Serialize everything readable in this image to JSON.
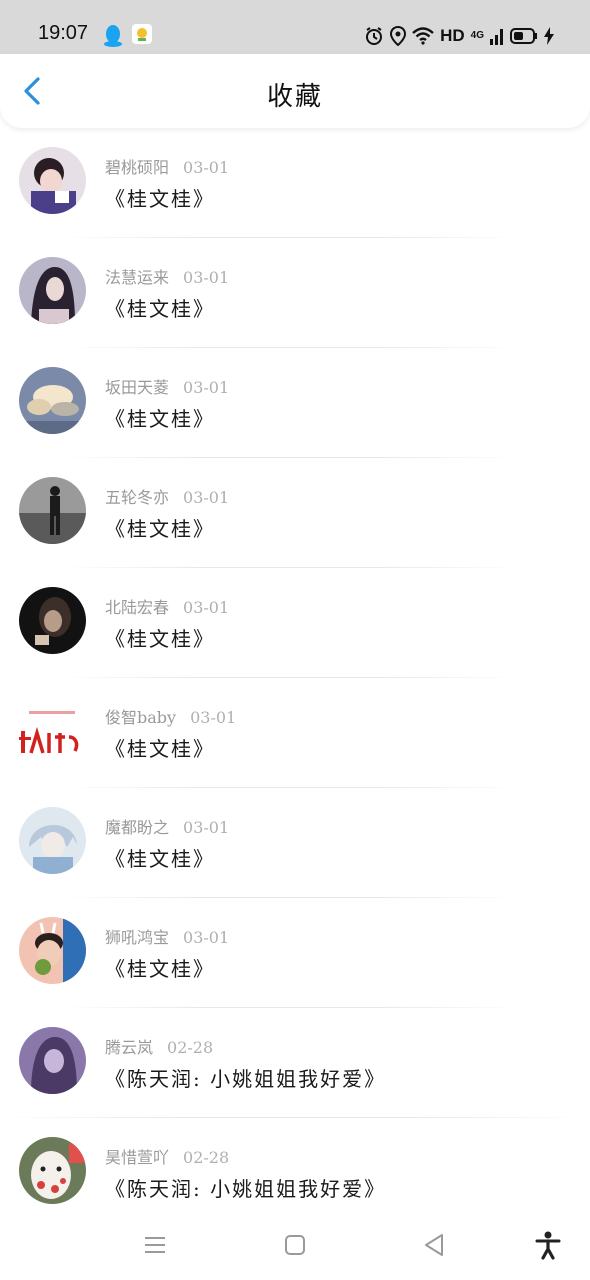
{
  "status_bar": {
    "time": "19:07",
    "hd_label": "HD",
    "network_label": "4G",
    "icons": [
      "qq-icon",
      "app-icon",
      "alarm-icon",
      "location-icon",
      "wifi-icon",
      "signal-icon",
      "battery-icon",
      "charging-icon"
    ]
  },
  "header": {
    "title": "收藏",
    "back_icon": "chevron-left-icon",
    "accent_color": "#2a8fdc"
  },
  "favorites": [
    {
      "name": "碧桃硕阳",
      "date": "03-01",
      "content": "《桂文桂》"
    },
    {
      "name": "法慧运来",
      "date": "03-01",
      "content": "《桂文桂》"
    },
    {
      "name": "坂田天菱",
      "date": "03-01",
      "content": "《桂文桂》"
    },
    {
      "name": "五轮冬亦",
      "date": "03-01",
      "content": "《桂文桂》"
    },
    {
      "name": "北陆宏春",
      "date": "03-01",
      "content": "《桂文桂》"
    },
    {
      "name": "俊智baby",
      "date": "03-01",
      "content": "《桂文桂》"
    },
    {
      "name": "魔都盼之",
      "date": "03-01",
      "content": "《桂文桂》"
    },
    {
      "name": "狮吼鸿宝",
      "date": "03-01",
      "content": "《桂文桂》"
    },
    {
      "name": "腾云岚",
      "date": "02-28",
      "content": "《陈天润: 小姚姐姐我好爱》"
    },
    {
      "name": "昊惜萱吖",
      "date": "02-28",
      "content": "《陈天润: 小姚姐姐我好爱》"
    }
  ],
  "nav_bar": {
    "icons": [
      "menu-icon",
      "home-icon",
      "back-icon",
      "accessibility-icon"
    ]
  }
}
